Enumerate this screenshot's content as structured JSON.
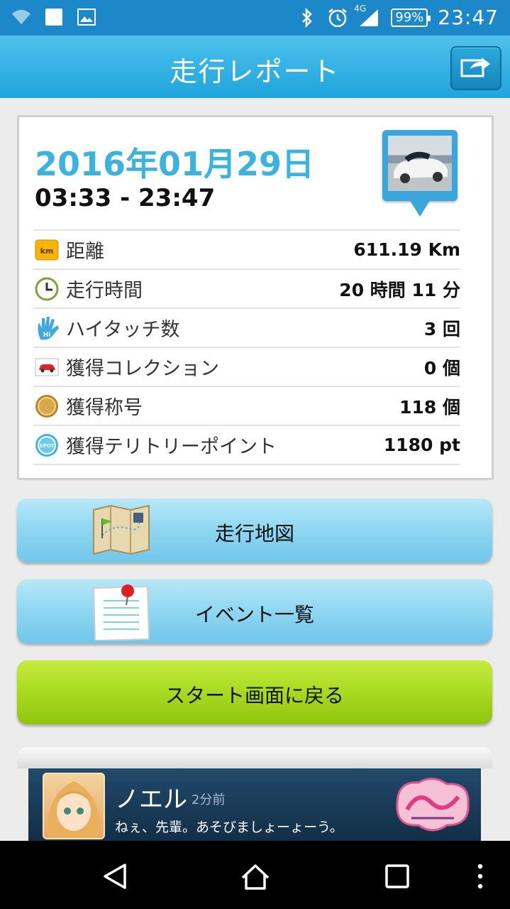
{
  "status_bar": {
    "battery": "99%",
    "network": "4G",
    "time": "23:47"
  },
  "app_bar": {
    "title": "走行レポート"
  },
  "report": {
    "date": "2016年01月29日",
    "time_range": "03:33 - 23:47",
    "rows": [
      {
        "icon": "km-icon",
        "icon_text": "km",
        "label": "距離",
        "value": "611.19 Km"
      },
      {
        "icon": "clock-icon",
        "label": "走行時間",
        "value": "20 時間 11 分"
      },
      {
        "icon": "high-five-icon",
        "icon_text": "Hi",
        "label": "ハイタッチ数",
        "value": "3 回"
      },
      {
        "icon": "car-icon",
        "label": "獲得コレクション",
        "value": "0 個"
      },
      {
        "icon": "medal-icon",
        "label": "獲得称号",
        "value": "118 個"
      },
      {
        "icon": "spot-icon",
        "icon_text": "SPOT",
        "label": "獲得テリトリーポイント",
        "value": "1180 pt"
      }
    ]
  },
  "buttons": {
    "map": "走行地図",
    "events": "イベント一覧",
    "start": "スタート画面に戻る"
  },
  "ad": {
    "name": "ノエル",
    "time_ago": "2分前",
    "message": "ねぇ、先輩。あそびましょーょーう。"
  },
  "colors": {
    "status_bar": "#1c87c9",
    "app_bar": "#2fb0e3",
    "date_text": "#3bb3de",
    "green_button": "#a6d81e",
    "blue_button": "#8fd6f1"
  }
}
